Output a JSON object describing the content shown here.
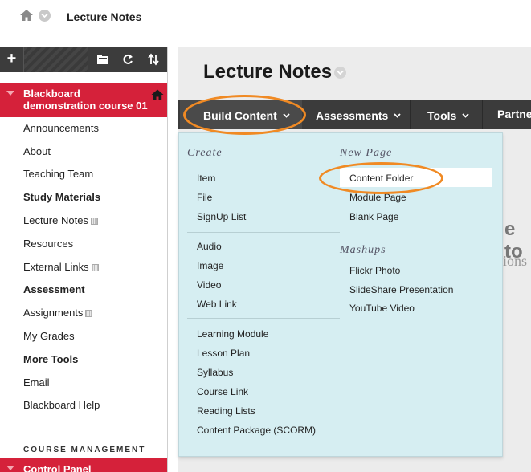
{
  "breadcrumb": {
    "current": "Lecture Notes"
  },
  "sidebar": {
    "course_title": "Blackboard demonstration course 01",
    "items": [
      {
        "label": "Announcements",
        "bold": false,
        "box": false
      },
      {
        "label": "About",
        "bold": false,
        "box": false
      },
      {
        "label": "Teaching Team",
        "bold": false,
        "box": false
      },
      {
        "label": "Study Materials",
        "bold": true,
        "box": false
      },
      {
        "label": "Lecture Notes",
        "bold": false,
        "box": true
      },
      {
        "label": "Resources",
        "bold": false,
        "box": false
      },
      {
        "label": "External Links",
        "bold": false,
        "box": true
      },
      {
        "label": "Assessment",
        "bold": true,
        "box": false
      },
      {
        "label": "Assignments",
        "bold": false,
        "box": true
      },
      {
        "label": "My Grades",
        "bold": false,
        "box": false
      },
      {
        "label": "More Tools",
        "bold": true,
        "box": false
      },
      {
        "label": "Email",
        "bold": false,
        "box": false
      },
      {
        "label": "Blackboard Help",
        "bold": false,
        "box": false
      }
    ],
    "course_management_label": "COURSE MANAGEMENT",
    "control_panel_label": "Control Panel"
  },
  "main": {
    "page_title": "Lecture Notes",
    "actions": [
      {
        "label": "Build Content"
      },
      {
        "label": "Assessments"
      },
      {
        "label": "Tools"
      },
      {
        "label": "Partne"
      }
    ],
    "background_text_1": "e to",
    "background_text_2": "ions"
  },
  "dropdown": {
    "create_heading": "Create",
    "create_items": [
      "Item",
      "File",
      "SignUp List",
      "Audio",
      "Image",
      "Video",
      "Web Link",
      "Learning Module",
      "Lesson Plan",
      "Syllabus",
      "Course Link",
      "Reading Lists",
      "Content Package (SCORM)"
    ],
    "new_page_heading": "New Page",
    "new_page_items": [
      "Content Folder",
      "Module Page",
      "Blank Page"
    ],
    "mashups_heading": "Mashups",
    "mashups_items": [
      "Flickr Photo",
      "SlideShare Presentation",
      "YouTube Video"
    ]
  },
  "colors": {
    "accent_red": "#d5213a",
    "annotation_orange": "#f08a24",
    "menu_bg": "#d6eef2",
    "action_bar": "#3b3b3b"
  }
}
